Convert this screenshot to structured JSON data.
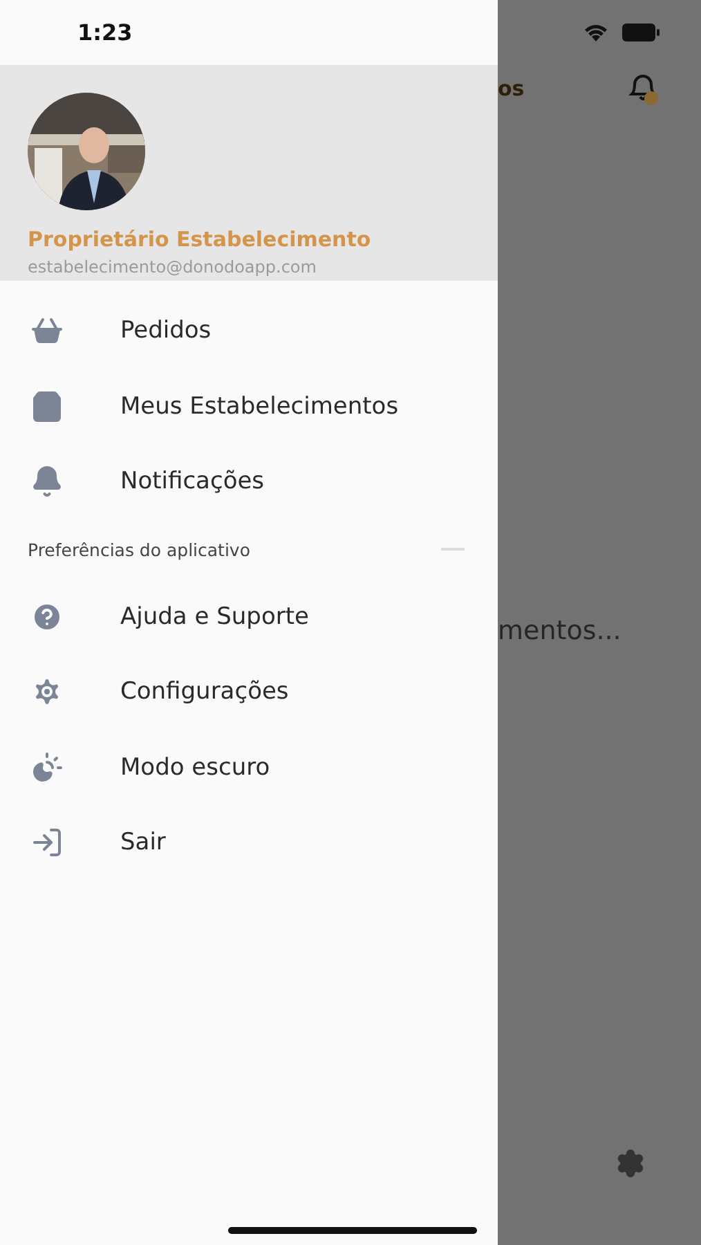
{
  "status_bar": {
    "time": "1:23"
  },
  "profile": {
    "name": "Proprietário Estabelecimento",
    "email": "estabelecimento@donodoapp.com"
  },
  "menu": [
    {
      "label": "Pedidos"
    },
    {
      "label": "Meus Estabelecimentos"
    },
    {
      "label": "Notificações"
    }
  ],
  "section": {
    "title": "Preferências do aplicativo"
  },
  "preferences": [
    {
      "label": "Ajuda e Suporte"
    },
    {
      "label": "Configurações"
    },
    {
      "label": "Modo escuro"
    },
    {
      "label": "Sair"
    }
  ],
  "background": {
    "header_fragment": "os",
    "loading_fragment": "mentos..."
  }
}
